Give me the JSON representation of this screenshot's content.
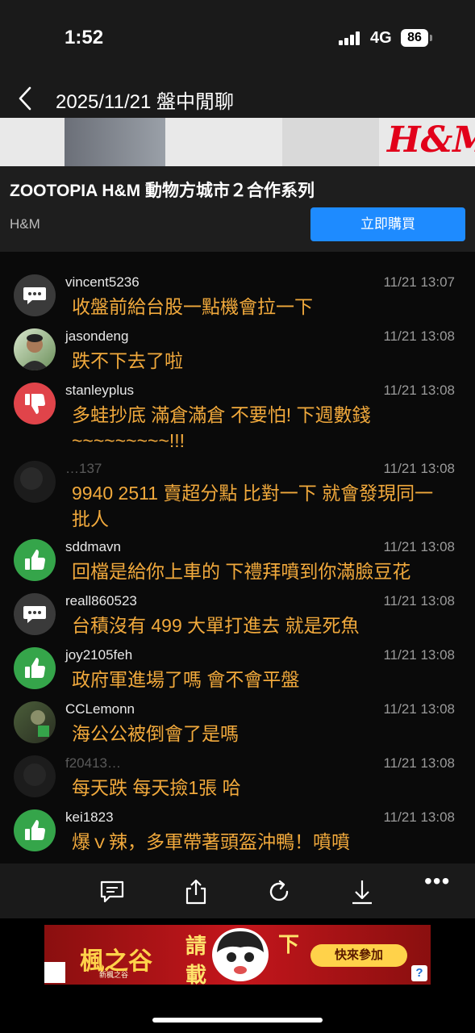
{
  "status": {
    "time": "1:52",
    "network": "4G",
    "battery": "86"
  },
  "nav": {
    "title": "2025/11/21 盤中閒聊"
  },
  "ad": {
    "image_logo": "H&M",
    "title": "ZOOTOPIA H&M 動物方城市２合作系列",
    "brand": "H&M",
    "buy_label": "立即購買"
  },
  "messages": [
    {
      "user": "vincent5236",
      "time": "11/21 13:07",
      "text": "收盤前給台股一點機會拉一下",
      "avatar": "chat-bubble-icon"
    },
    {
      "user": "jasondeng",
      "time": "11/21 13:08",
      "text": "跌不下去了啦",
      "avatar": "photo"
    },
    {
      "user": "stanleyplus",
      "time": "11/21 13:08",
      "text": "多蛙抄底  滿倉滿倉  不要怕! 下週數錢~~~~~~~~~!!!",
      "avatar": "thumbs-down-icon"
    },
    {
      "user": "…137",
      "time": "11/21 13:08",
      "text": "9940 2511 賣超分點 比對一下 就會發現同一批人",
      "avatar": "photo-dark"
    },
    {
      "user": "sddmavn",
      "time": "11/21 13:08",
      "text": "回檔是給你上車的 下禮拜噴到你滿臉豆花",
      "avatar": "thumbs-up-icon"
    },
    {
      "user": "reall860523",
      "time": "11/21 13:08",
      "text": "台積沒有 499 大單打進去 就是死魚",
      "avatar": "chat-bubble-icon"
    },
    {
      "user": "joy2105feh",
      "time": "11/21 13:08",
      "text": "政府軍進場了嗎 會不會平盤",
      "avatar": "thumbs-up-icon"
    },
    {
      "user": "CCLemonn",
      "time": "11/21 13:08",
      "text": "海公公被倒會了是嗎",
      "avatar": "photo-forest"
    },
    {
      "user": "f20413…",
      "time": "11/21 13:08",
      "text": "每天跌 每天撿1張 哈",
      "avatar": "photo-dark"
    },
    {
      "user": "kei1823",
      "time": "11/21 13:08",
      "text": "爆ｖ辣，多軍帶著頭盔沖鴨！噴噴",
      "avatar": "thumbs-up-icon"
    }
  ],
  "toolbar": {
    "icons": [
      "comment-icon",
      "share-icon",
      "refresh-icon",
      "download-icon"
    ],
    "more": "•••"
  },
  "game_ad": {
    "logo": "楓之谷",
    "subtitle": "新楓之谷",
    "char_a": "請",
    "char_b": "載",
    "char_c": "下",
    "button": "快來參加",
    "help": "?"
  }
}
